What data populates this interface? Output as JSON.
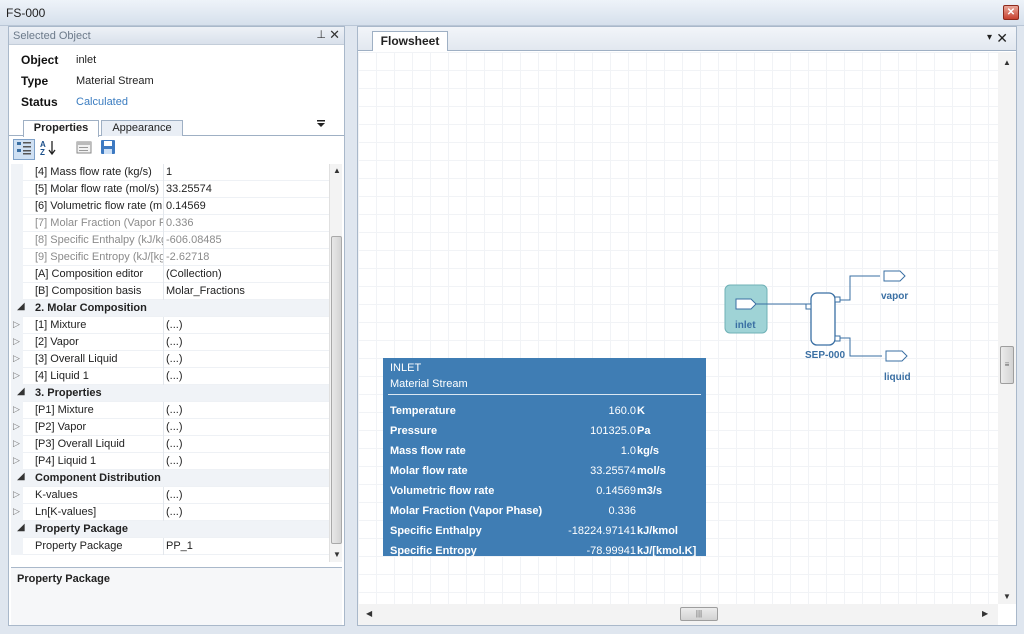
{
  "window": {
    "title": "FS-000",
    "close_symbol": "✕"
  },
  "selected_panel": {
    "header": "Selected Object",
    "pin_symbol": "⊥",
    "close_symbol": "✕",
    "object_label": "Object",
    "object_value": "inlet",
    "type_label": "Type",
    "type_value": "Material Stream",
    "status_label": "Status",
    "status_value": "Calculated",
    "status_color": "#3a7cc0"
  },
  "property_tabs": [
    {
      "label": "Properties"
    },
    {
      "label": "Appearance"
    }
  ],
  "grid": {
    "rows": [
      {
        "name": "[4] Mass flow rate (kg/s)",
        "value": "1",
        "kind": "prop"
      },
      {
        "name": "[5] Molar flow rate (mol/s)",
        "value": "33.25574",
        "kind": "prop"
      },
      {
        "name": "[6] Volumetric flow rate (m",
        "value": "0.14569",
        "kind": "prop"
      },
      {
        "name": "[7] Molar Fraction (Vapor P",
        "value": "0.336",
        "kind": "disabled"
      },
      {
        "name": "[8] Specific Enthalpy (kJ/kg",
        "value": "-606.08485",
        "kind": "disabled"
      },
      {
        "name": "[9] Specific Entropy (kJ/[kg",
        "value": "-2.62718",
        "kind": "disabled"
      },
      {
        "name": "[A] Composition editor",
        "value": "(Collection)",
        "kind": "prop"
      },
      {
        "name": "[B] Composition basis",
        "value": "Molar_Fractions",
        "kind": "prop"
      },
      {
        "name": "2. Molar Composition",
        "value": "",
        "kind": "cat"
      },
      {
        "name": "[1] Mixture",
        "value": "(...)",
        "kind": "exp"
      },
      {
        "name": "[2] Vapor",
        "value": "(...)",
        "kind": "exp"
      },
      {
        "name": "[3] Overall Liquid",
        "value": "(...)",
        "kind": "exp"
      },
      {
        "name": "[4] Liquid 1",
        "value": "(...)",
        "kind": "exp"
      },
      {
        "name": "3. Properties",
        "value": "",
        "kind": "cat"
      },
      {
        "name": "[P1] Mixture",
        "value": "(...)",
        "kind": "exp"
      },
      {
        "name": "[P2] Vapor",
        "value": "(...)",
        "kind": "exp"
      },
      {
        "name": "[P3] Overall Liquid",
        "value": "(...)",
        "kind": "exp"
      },
      {
        "name": "[P4] Liquid 1",
        "value": "(...)",
        "kind": "exp"
      },
      {
        "name": "Component Distribution",
        "value": "",
        "kind": "cat"
      },
      {
        "name": "K-values",
        "value": "(...)",
        "kind": "exp"
      },
      {
        "name": "Ln[K-values]",
        "value": "(...)",
        "kind": "exp"
      },
      {
        "name": "Property Package",
        "value": "",
        "kind": "cat"
      },
      {
        "name": "Property Package",
        "value": "PP_1",
        "kind": "prop"
      }
    ]
  },
  "description_box": {
    "title": "Property Package"
  },
  "flowsheet": {
    "tab_label": "Flowsheet",
    "dropdown_symbol": "▾",
    "close_symbol": "✕",
    "info_box": {
      "title": "INLET",
      "subtitle": "Material Stream",
      "rows": [
        {
          "name": "Temperature",
          "value": "160.0",
          "unit": "K"
        },
        {
          "name": "Pressure",
          "value": "101325.0",
          "unit": "Pa"
        },
        {
          "name": "Mass flow rate",
          "value": "1.0",
          "unit": "kg/s"
        },
        {
          "name": "Molar flow rate",
          "value": "33.25574",
          "unit": "mol/s"
        },
        {
          "name": "Volumetric flow rate",
          "value": "0.14569",
          "unit": "m3/s"
        },
        {
          "name": "Molar Fraction (Vapor Phase)",
          "value": "0.336",
          "unit": ""
        },
        {
          "name": "Specific Enthalpy",
          "value": "-18224.97141",
          "unit": "kJ/kmol"
        },
        {
          "name": "Specific Entropy",
          "value": "-78.99941",
          "unit": "kJ/[kmol.K]"
        }
      ]
    },
    "objects": {
      "inlet_label": "inlet",
      "separator_label": "SEP-000",
      "vapor_label": "vapor",
      "liquid_label": "liquid"
    }
  },
  "colors": {
    "info_box_bg": "#3f7db4",
    "stream_label": "#3a6fa3",
    "selection_fill": "#9fd3d6"
  }
}
